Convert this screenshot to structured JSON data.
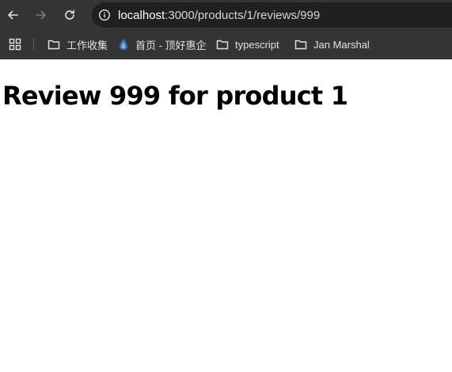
{
  "browser": {
    "url_host": "localhost",
    "url_rest": ":3000/products/1/reviews/999",
    "bookmarks": [
      {
        "label": "工作收集",
        "icon": "folder-icon"
      },
      {
        "label": "首页 - 顶好惠企",
        "icon": "site-favicon"
      },
      {
        "label": "typescript",
        "icon": "folder-icon"
      },
      {
        "label": "Jan Marshal",
        "icon": "folder-icon"
      }
    ]
  },
  "page": {
    "heading": "Review 999 for product 1"
  },
  "colors": {
    "toolbar_bg": "#353535",
    "omnibox_bg": "#202020",
    "page_bg": "#ffffff"
  }
}
